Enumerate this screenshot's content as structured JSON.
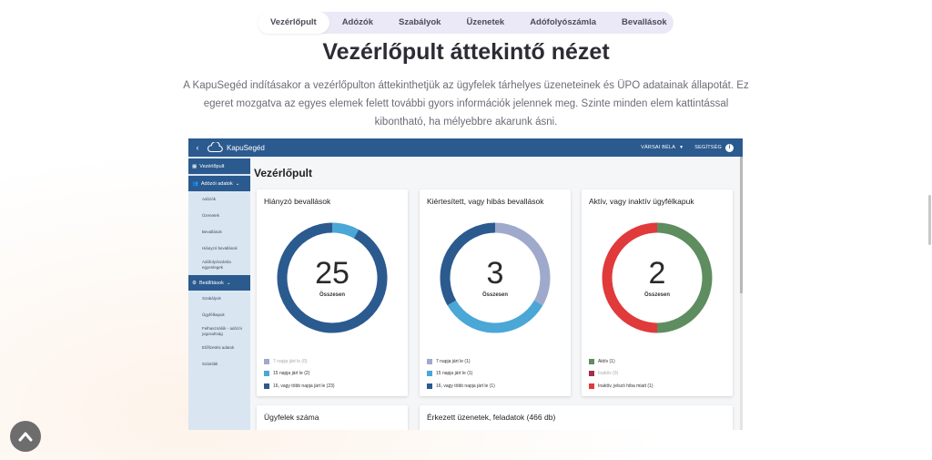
{
  "nav": {
    "tabs": [
      "Vezérlőpult",
      "Adózók",
      "Szabályok",
      "Üzenetek",
      "Adófolyószámla",
      "Bevallások"
    ],
    "active": "Vezérlőpult"
  },
  "hero": {
    "title": "Vezérlőpult áttekintő nézet",
    "description": "A KapuSegéd indításakor a vezérlőpulton áttekinthetjük az ügyfelek tárhelyes üzeneteinek és ÜPO adatainak állapotát. Ez egeret mozgatva az egyes elemek felett további gyors információk jelennek meg. Szinte minden elem kattintással kibontható, ha mélyebbre akarunk ásni."
  },
  "app": {
    "brand": "KapuSegéd",
    "back_icon": "chevron-left-icon",
    "user": "VÁRSAI BÉLA",
    "help": "SEGÍTSÉG",
    "help_icon": "info-icon",
    "sidebar": {
      "dashboard": "Vezérlőpult",
      "taxpayer_section": "Adózói adatok",
      "taxpayer_items": [
        "Adózók",
        "Üzenetek",
        "Bevallások",
        "Hiányzó bevallások",
        "Adófolyószámla egyenlegek"
      ],
      "settings_section": "Beállítások",
      "settings_items": [
        "Szabályok",
        "Ügyfélkapuk",
        "Felhasználók - adózói jogosultság",
        "Előfizetési adatok",
        "Számlák"
      ]
    },
    "page_title": "Vezérlőpult",
    "cards": [
      {
        "title": "Hiányzó bevallások",
        "total": "25",
        "total_label": "Összesen",
        "segments": [
          {
            "label": "7 napja járt le (0)",
            "value": 0,
            "color": "#9fa9cc",
            "dim": true
          },
          {
            "label": "15 napja járt le (2)",
            "value": 2,
            "color": "#4aa7d6",
            "dim": false
          },
          {
            "label": "16, vagy több napja járt le (23)",
            "value": 23,
            "color": "#2b5a8f",
            "dim": false
          }
        ]
      },
      {
        "title": "Kiértesített, vagy hibás bevallások",
        "total": "3",
        "total_label": "Összesen",
        "segments": [
          {
            "label": "7 napja járt le (1)",
            "value": 1,
            "color": "#9fa9cc",
            "dim": false
          },
          {
            "label": "15 napja járt le (1)",
            "value": 1,
            "color": "#4aa7d6",
            "dim": false
          },
          {
            "label": "16, vagy több napja járt le (1)",
            "value": 1,
            "color": "#2b5a8f",
            "dim": false
          }
        ]
      },
      {
        "title": "Aktív, vagy inaktív ügyfélkapuk",
        "total": "2",
        "total_label": "Összesen",
        "segments": [
          {
            "label": "Aktív (1)",
            "value": 1,
            "color": "#5e8d60",
            "dim": false
          },
          {
            "label": "Inaktív (0)",
            "value": 0,
            "color": "#a3304a",
            "dim": true
          },
          {
            "label": "Inaktív, jelszó hiba miatt (1)",
            "value": 1,
            "color": "#e03a3a",
            "dim": false
          }
        ]
      }
    ],
    "bottom_cards": [
      "Ügyfelek száma",
      "Érkezett üzenetek, feladatok (466 db)"
    ]
  },
  "scroll_top_icon": "chevron-up-icon"
}
